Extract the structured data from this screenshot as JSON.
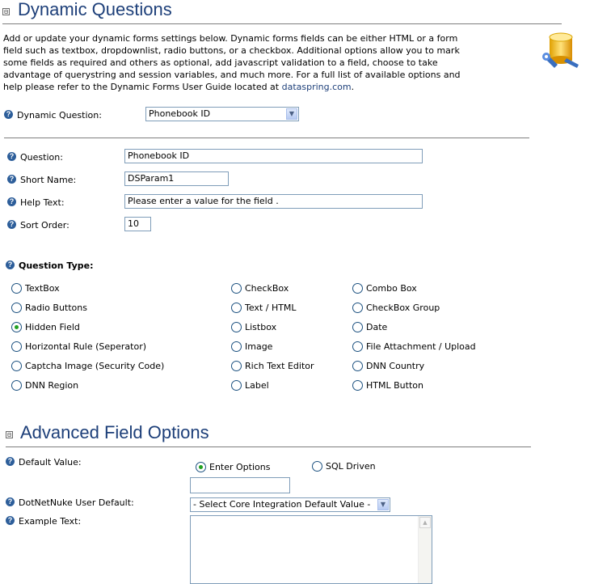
{
  "header": {
    "collapse_symbol": "⊟",
    "title": "Dynamic Questions",
    "description_lines": [
      "Add or update your dynamic forms settings below. Dynamic forms fields can be either HTML or a form",
      "field such as textbox, dropdownlist, radio buttons, or a checkbox. Additional options allow you to mark",
      "some fields as required and others as optional, add javascript validation to a field, choose to take",
      "advantage of querystring and session variables, and much more. For a full list of available options and"
    ],
    "description_last_prefix": "help please refer to the Dynamic Forms User Guide located at ",
    "description_link": "dataspring.com",
    "description_last_suffix": "."
  },
  "dynamic_question": {
    "label": "Dynamic Question:",
    "selected": "Phonebook ID"
  },
  "fields": {
    "question": {
      "label": "Question:",
      "value": "Phonebook ID"
    },
    "short_name": {
      "label": "Short Name:",
      "value": "DSParam1"
    },
    "help_text": {
      "label": "Help Text:",
      "value": "Please enter a value for the field ."
    },
    "sort_order": {
      "label": "Sort Order:",
      "value": "10"
    }
  },
  "question_type": {
    "label": "Question Type:",
    "selected": "Hidden Field",
    "col1": [
      "TextBox",
      "Radio Buttons",
      "Hidden Field",
      "Horizontal Rule (Seperator)",
      "Captcha Image (Security Code)",
      "DNN Region"
    ],
    "col2": [
      "CheckBox",
      "Text / HTML",
      "Listbox",
      "Image",
      "Rich Text Editor",
      "Label"
    ],
    "col3": [
      "Combo Box",
      "CheckBox Group",
      "Date",
      "File Attachment / Upload",
      "DNN Country",
      "HTML Button"
    ]
  },
  "advanced": {
    "title": "Advanced Field Options",
    "default_value": {
      "label": "Default Value:",
      "options": [
        "Enter Options",
        "SQL Driven"
      ],
      "selected": "Enter Options",
      "input_value": ""
    },
    "dnn_user_default": {
      "label": "DotNetNuke User Default:",
      "selected": "- Select Core Integration Default Value -"
    },
    "example_text": {
      "label": "Example Text:",
      "value": ""
    }
  },
  "help_icon_glyph": "?",
  "select_arrow_glyph": "▼",
  "scroll_up_glyph": "▲",
  "colors": {
    "heading": "#1d3f79",
    "help_icon": "#2d5e9a",
    "radio_checked": "#21a121",
    "input_border": "#7f9db9"
  }
}
